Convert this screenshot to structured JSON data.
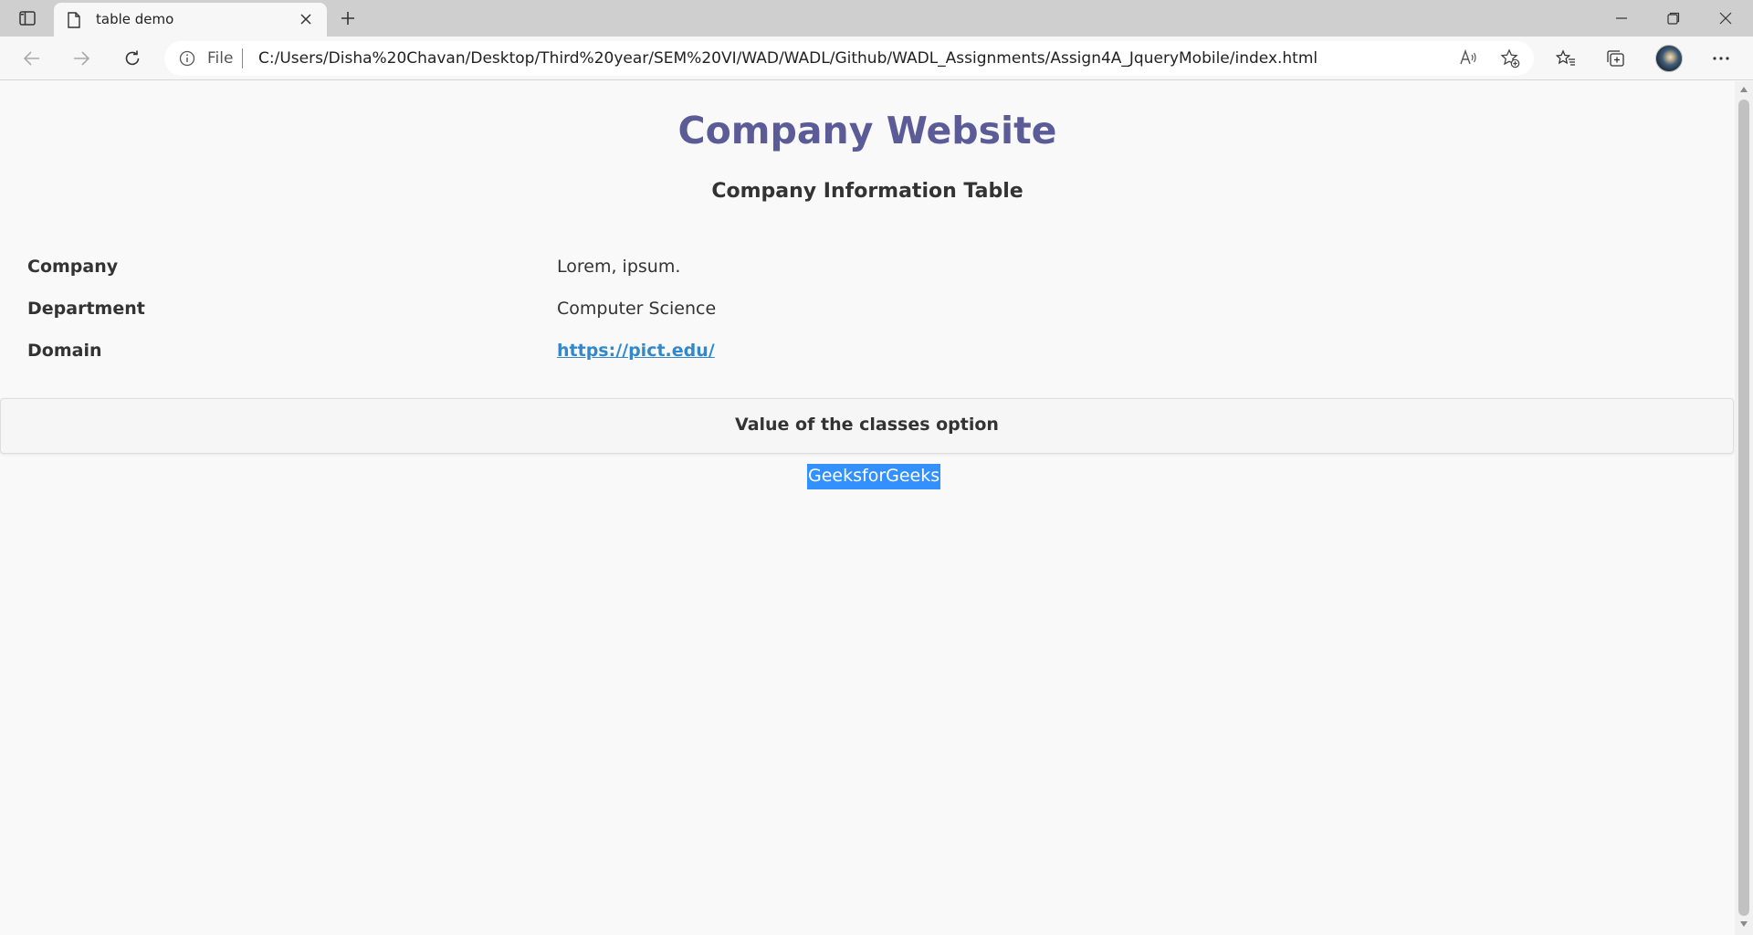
{
  "browser": {
    "tab": {
      "title": "table demo"
    },
    "address": {
      "scheme": "File",
      "url": "C:/Users/Disha%20Chavan/Desktop/Third%20year/SEM%20VI/WAD/WADL/Github/WADL_Assignments/Assign4A_JqueryMobile/index.html"
    },
    "icons": [
      "sidebar-toggle-icon",
      "page-icon",
      "close-icon",
      "plus-icon",
      "minimize-icon",
      "restore-icon",
      "close-window-icon",
      "back-arrow-icon",
      "forward-arrow-icon",
      "refresh-icon",
      "info-icon",
      "read-aloud-icon",
      "add-favorite-icon",
      "favorites-icon",
      "collections-icon",
      "profile-avatar",
      "more-icon"
    ]
  },
  "page": {
    "title": "Company Website",
    "subtitle": "Company Information Table",
    "rows": [
      {
        "label": "Company",
        "value": "Lorem, ipsum."
      },
      {
        "label": "Department",
        "value": "Computer Science"
      },
      {
        "label": "Domain",
        "value": " https://pict.edu/"
      }
    ],
    "bar_title": "Value of the classes option",
    "selected_text": "GeeksforGeeks"
  },
  "colors": {
    "title": "#5b5b98",
    "link": "#3388cc",
    "selection": "#3390ff"
  }
}
